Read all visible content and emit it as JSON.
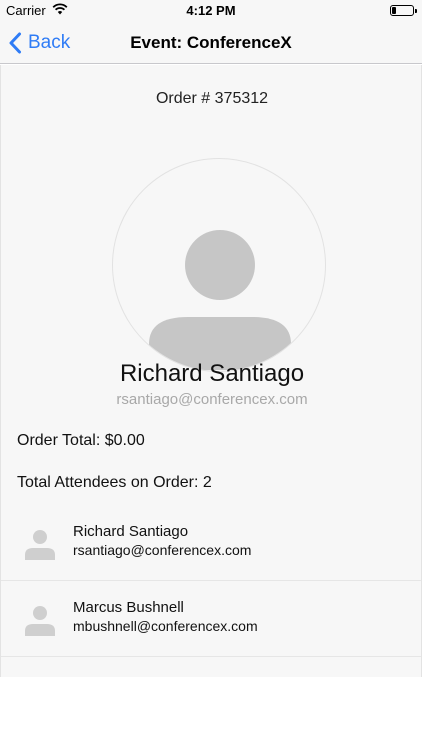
{
  "status_bar": {
    "carrier": "Carrier",
    "time": "4:12 PM",
    "battery_level": 0.15
  },
  "nav": {
    "back_label": "Back",
    "title": "Event: ConferenceX",
    "accent_color": "#2f7cf6"
  },
  "order": {
    "number_label": "Order # 375312",
    "total_label": "Order Total: $0.00",
    "attendees_label": "Total Attendees on Order: 2"
  },
  "profile": {
    "name": "Richard Santiago",
    "email": "rsantiago@conferencex.com",
    "avatar_icon": "person-placeholder-icon"
  },
  "attendees": [
    {
      "name": "Richard Santiago",
      "email": "rsantiago@conferencex.com",
      "icon": "person-icon"
    },
    {
      "name": "Marcus Bushnell",
      "email": "mbushnell@conferencex.com",
      "icon": "person-icon"
    }
  ]
}
